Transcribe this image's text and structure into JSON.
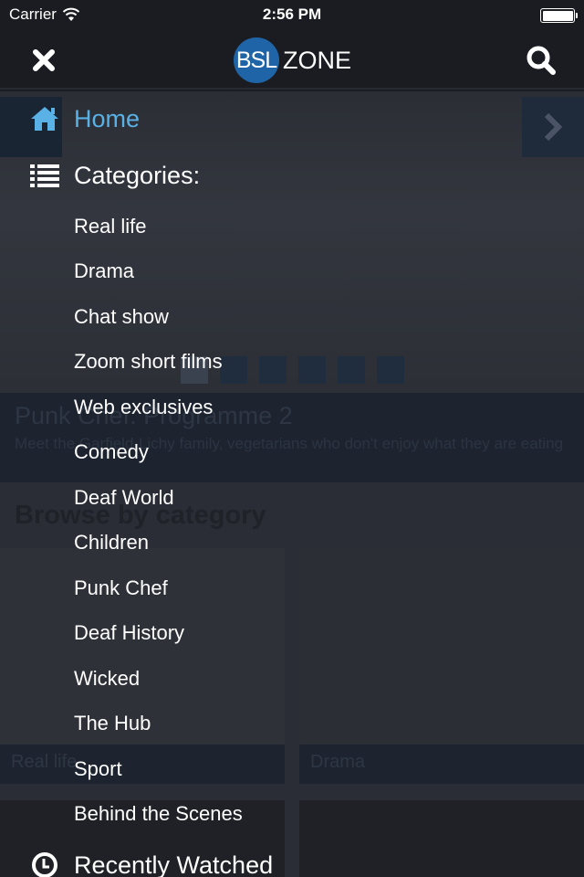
{
  "status_bar": {
    "carrier": "Carrier",
    "time": "2:56 PM"
  },
  "nav": {
    "logo_left": "BSL",
    "logo_right": "ZONE",
    "close_icon": "close-icon",
    "search_icon": "search-icon"
  },
  "menu": {
    "home": {
      "label": "Home",
      "icon": "home-icon"
    },
    "categories": {
      "label": "Categories:",
      "icon": "list-icon"
    },
    "category_items": [
      "Real life",
      "Drama",
      "Chat show",
      "Zoom short films",
      "Web exclusives",
      "Comedy",
      "Deaf World",
      "Children",
      "Punk Chef",
      "Deaf History",
      "Wicked",
      "The Hub",
      "Sport",
      "Behind the Scenes"
    ],
    "recently_watched": {
      "label": "Recently Watched",
      "icon": "clock-icon"
    }
  },
  "background": {
    "hero": {
      "title": "Punk Chef: Programme 2",
      "description": "Meet the Garfield-Lichy family, vegetarians who don't enjoy what they are eating",
      "slide_count": 6,
      "active_slide": 1
    },
    "browse_title": "Browse by category",
    "tiles": [
      "Real life",
      "Drama"
    ]
  },
  "colors": {
    "accent": "#59b1e6",
    "logo_blue": "#1f64a6",
    "header_bg": "#1b1c22"
  }
}
